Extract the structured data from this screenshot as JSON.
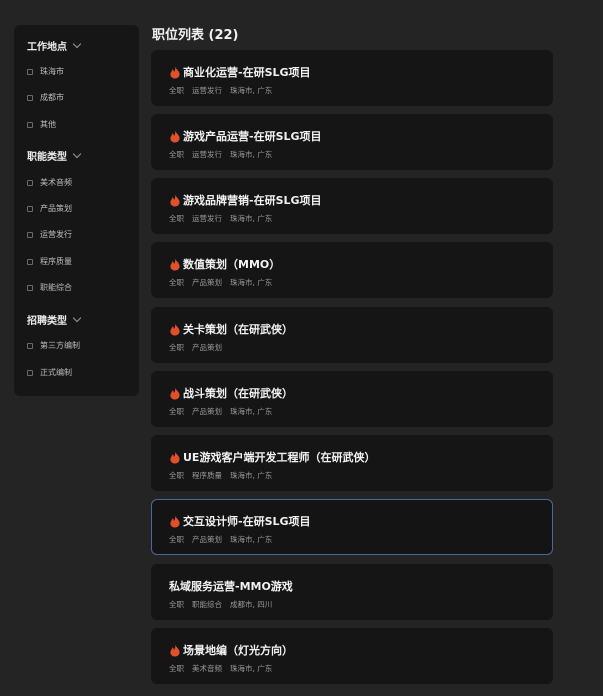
{
  "sidebar": {
    "groups": [
      {
        "label": "工作地点",
        "items": [
          "珠海市",
          "成都市",
          "其他"
        ]
      },
      {
        "label": "职能类型",
        "items": [
          "美术音频",
          "产品策划",
          "运营发行",
          "程序质量",
          "职能综合"
        ]
      },
      {
        "label": "招聘类型",
        "items": [
          "第三方编制",
          "正式编制"
        ]
      }
    ]
  },
  "list": {
    "title": "职位列表 (22)",
    "jobs": [
      {
        "title": "商业化运营-在研SLG项目",
        "type": "全职",
        "category": "运营发行",
        "location": "珠海市, 广东",
        "hot": true
      },
      {
        "title": "游戏产品运营-在研SLG项目",
        "type": "全职",
        "category": "运营发行",
        "location": "珠海市, 广东",
        "hot": true
      },
      {
        "title": "游戏品牌营销-在研SLG项目",
        "type": "全职",
        "category": "运营发行",
        "location": "珠海市, 广东",
        "hot": true
      },
      {
        "title": "数值策划（MMO）",
        "type": "全职",
        "category": "产品策划",
        "location": "珠海市, 广东",
        "hot": true
      },
      {
        "title": "关卡策划（在研武侠）",
        "type": "全职",
        "category": "产品策划",
        "location": "",
        "hot": true
      },
      {
        "title": "战斗策划（在研武侠）",
        "type": "全职",
        "category": "产品策划",
        "location": "珠海市, 广东",
        "hot": true
      },
      {
        "title": "UE游戏客户端开发工程师（在研武侠）",
        "type": "全职",
        "category": "程序质量",
        "location": "珠海市, 广东",
        "hot": true
      },
      {
        "title": "交互设计师-在研SLG项目",
        "type": "全职",
        "category": "产品策划",
        "location": "珠海市, 广东",
        "hot": true,
        "active": true
      },
      {
        "title": "私域服务运营-MMO游戏",
        "type": "全职",
        "category": "职能综合",
        "location": "成都市, 四川",
        "hot": false
      },
      {
        "title": "场景地编（灯光方向）",
        "type": "全职",
        "category": "美术音频",
        "location": "珠海市, 广东",
        "hot": true
      }
    ]
  },
  "colors": {
    "fire": "#e0512a",
    "active_border": "#4a6a9a"
  }
}
